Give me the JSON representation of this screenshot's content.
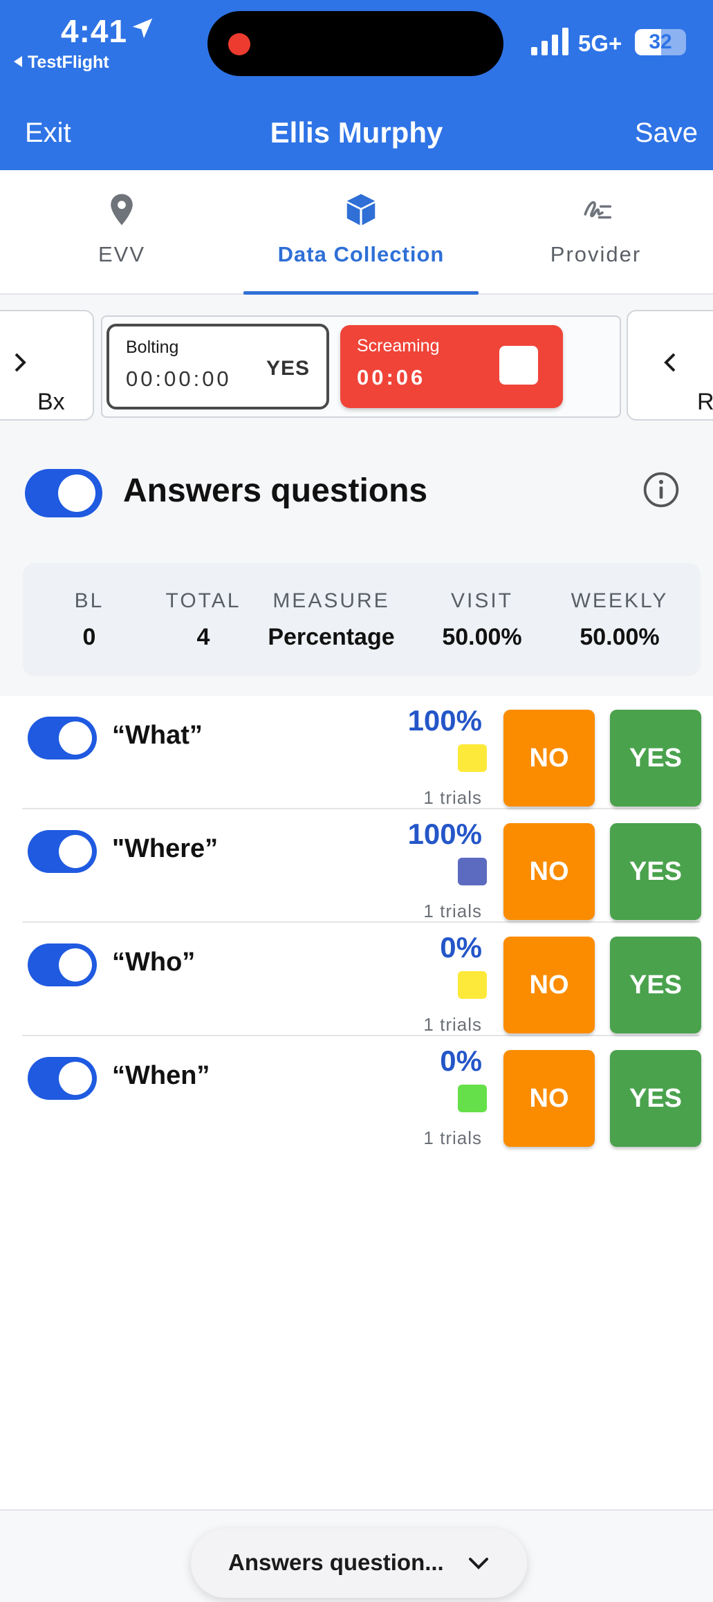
{
  "status_bar": {
    "time": "4:41",
    "back_app": "TestFlight",
    "network": "5G+",
    "battery": "32"
  },
  "nav": {
    "exit_label": "Exit",
    "title": "Ellis Murphy",
    "save_label": "Save"
  },
  "tabs": [
    {
      "label": "EVV",
      "icon": "location-pin-icon",
      "active": false
    },
    {
      "label": "Data Collection",
      "icon": "cube-icon",
      "active": true
    },
    {
      "label": "Provider",
      "icon": "signature-icon",
      "active": false
    }
  ],
  "behavior_strip": {
    "left_label": "Bx",
    "right_label": "Rx",
    "behaviors": [
      {
        "name": "Bolting",
        "timer": "00:00:00",
        "action": "YES",
        "active": false
      },
      {
        "name": "Screaming",
        "timer": "00:06",
        "active": true
      }
    ]
  },
  "program": {
    "title": "Answers questions",
    "enabled": true
  },
  "stats": [
    {
      "label": "BL",
      "value": "0"
    },
    {
      "label": "TOTAL",
      "value": "4"
    },
    {
      "label": "MEASURE",
      "value": "Percentage"
    },
    {
      "label": "VISIT",
      "value": "50.00%"
    },
    {
      "label": "WEEKLY",
      "value": "50.00%"
    }
  ],
  "targets": [
    {
      "name": "“What”",
      "percent": "100%",
      "color": "#fde93a",
      "trials": "1 trials",
      "no_label": "NO",
      "yes_label": "YES"
    },
    {
      "name": "\"Where”",
      "percent": "100%",
      "color": "#5c6bc0",
      "trials": "1 trials",
      "no_label": "NO",
      "yes_label": "YES"
    },
    {
      "name": "“Who”",
      "percent": "0%",
      "color": "#fde93a",
      "trials": "1 trials",
      "no_label": "NO",
      "yes_label": "YES"
    },
    {
      "name": "“When”",
      "percent": "0%",
      "color": "#66e04a",
      "trials": "1 trials",
      "no_label": "NO",
      "yes_label": "YES"
    }
  ],
  "bottom": {
    "selector_label": "Answers question..."
  },
  "colors": {
    "header_blue": "#2f74e6",
    "accent_blue": "#2f6fd6",
    "toggle_blue": "#1f5ae0",
    "no_orange": "#fb8c00",
    "yes_green": "#4aa24d",
    "screaming_red": "#f04438"
  }
}
